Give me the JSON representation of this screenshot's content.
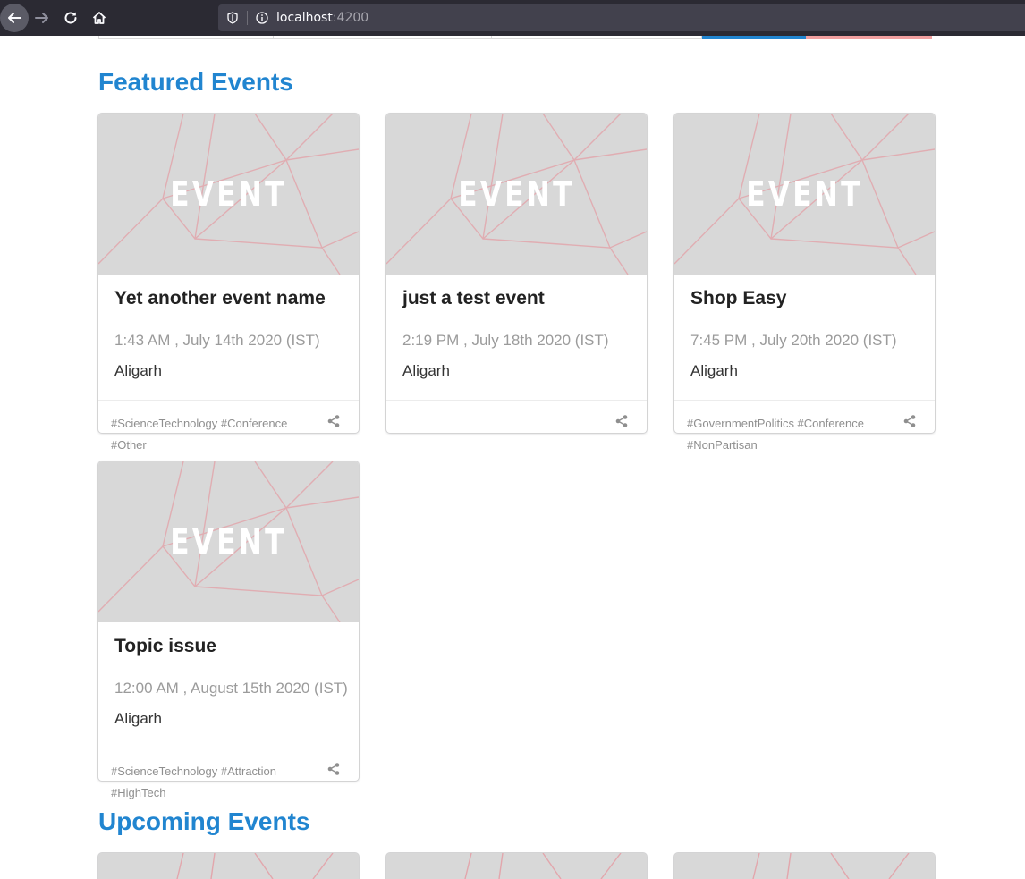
{
  "browser": {
    "url_host": "localhost",
    "url_port": ":4200"
  },
  "sections": {
    "featured_title": "Featured Events",
    "upcoming_title": "Upcoming Events"
  },
  "placeholder_image_text": "EVENT",
  "featured_events": [
    {
      "title": "Yet another event name",
      "time": "1:43 AM , July 14th 2020 (IST)",
      "location": "Aligarh",
      "tags": "#ScienceTechnology #Conference #Other"
    },
    {
      "title": "just a test event",
      "time": "2:19 PM , July 18th 2020 (IST)",
      "location": "Aligarh",
      "tags": ""
    },
    {
      "title": "Shop Easy",
      "time": "7:45 PM , July 20th 2020 (IST)",
      "location": "Aligarh",
      "tags": "#GovernmentPolitics #Conference #NonPartisan"
    },
    {
      "title": "Topic issue",
      "time": "12:00 AM , August 15th 2020 (IST)",
      "location": "Aligarh",
      "tags": "#ScienceTechnology #Attraction #HighTech"
    }
  ],
  "icons": {
    "share": "share-icon",
    "back": "arrow-left-icon",
    "forward": "arrow-right-icon",
    "reload": "reload-icon",
    "home": "home-icon",
    "shield": "shield-icon",
    "info": "info-icon"
  },
  "colors": {
    "section_title": "#2185d0",
    "placeholder_bg": "#d8d8d8",
    "placeholder_lines": "#e2a6ac",
    "strip_blue": "#2185d0",
    "strip_red": "#f2a0a0"
  }
}
